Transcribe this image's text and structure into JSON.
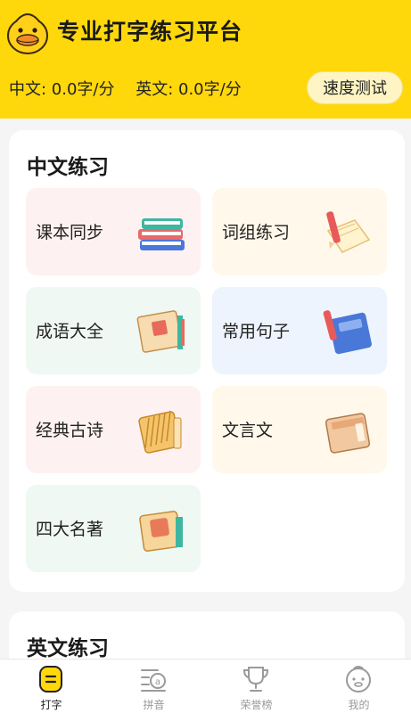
{
  "header": {
    "title": "专业打字练习平台",
    "cn_speed": "中文: 0.0字/分",
    "en_speed": "英文: 0.0字/分",
    "speed_test_label": "速度测试"
  },
  "chinese_section": {
    "title": "中文练习",
    "items": [
      {
        "label": "课本同步",
        "icon": "textbook-stack-icon"
      },
      {
        "label": "词组练习",
        "icon": "notebook-pencil-icon"
      },
      {
        "label": "成语大全",
        "icon": "scroll-book-icon"
      },
      {
        "label": "常用句子",
        "icon": "blue-notebook-pencil-icon"
      },
      {
        "label": "经典古诗",
        "icon": "bamboo-book-icon"
      },
      {
        "label": "文言文",
        "icon": "ancient-book-icon"
      },
      {
        "label": "四大名著",
        "icon": "classic-novel-icon"
      }
    ]
  },
  "english_section": {
    "title": "英文练习"
  },
  "tabbar": {
    "items": [
      {
        "label": "打字",
        "icon": "typing-icon",
        "active": true
      },
      {
        "label": "拼音",
        "icon": "pinyin-icon",
        "active": false
      },
      {
        "label": "荣誉榜",
        "icon": "trophy-icon",
        "active": false
      },
      {
        "label": "我的",
        "icon": "profile-face-icon",
        "active": false
      }
    ]
  },
  "colors": {
    "brand_yellow": "#ffd80c",
    "tile_pink": "#fdf2f1",
    "tile_cream": "#fff8eb",
    "tile_mint": "#eff8f2",
    "tile_blue": "#eef4fd"
  }
}
